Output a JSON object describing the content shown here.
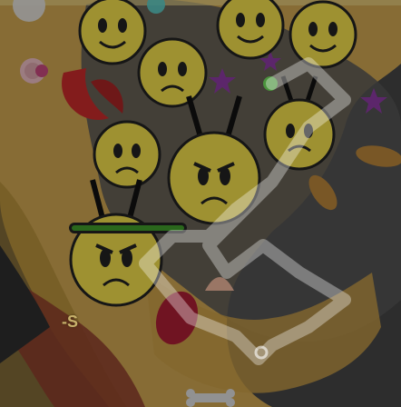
{
  "scene": {
    "partial_hud_text": "-S",
    "colors": {
      "sand": "#c9a24f",
      "sand_dark": "#a5802f",
      "dark_ground": "#4b4b4b",
      "dark_ground_shade": "#3a3a3a",
      "reddish": "#8a3b2a",
      "mob_yellow": "#ecd84a",
      "mob_outline": "#222222",
      "health_green": "#3f9a2a",
      "dim_overlay": "rgba(0,0,0,0.33)"
    }
  },
  "mobs": [
    {
      "kind": "bee",
      "mood": "happy",
      "antennae": false
    },
    {
      "kind": "bee",
      "mood": "happy",
      "antennae": false
    },
    {
      "kind": "bee",
      "mood": "happy",
      "antennae": false
    },
    {
      "kind": "bee",
      "mood": "sad",
      "antennae": false
    },
    {
      "kind": "bee",
      "mood": "sad",
      "antennae": false
    },
    {
      "kind": "bee",
      "mood": "angry",
      "antennae": true
    },
    {
      "kind": "bee",
      "mood": "sad",
      "antennae": true
    },
    {
      "kind": "bee",
      "mood": "angry",
      "antennae": true,
      "health_fraction": 1.0
    }
  ],
  "petals": [
    "purple-star-petal",
    "purple-star-petal",
    "purple-star-petal",
    "pink-flower-petal",
    "green-dot-petal",
    "peanut-petal",
    "peanut-petal",
    "bone-petal",
    "shell-petal",
    "red-leaf-petal",
    "red-leaf-petal"
  ]
}
